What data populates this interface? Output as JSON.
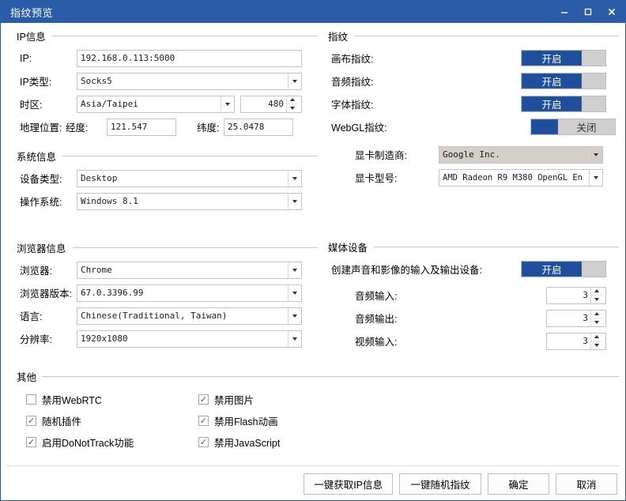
{
  "window": {
    "title": "指纹预览",
    "controls": {
      "minimize": "–",
      "maximize": "□",
      "close": "✕"
    },
    "titlebar_color": "#2a5ca8",
    "accent_color": "#1f4e9c"
  },
  "ip_section": {
    "title": "IP信息",
    "ip_label": "IP:",
    "ip_value": "192.168.0.113:5000",
    "ip_type_label": "IP类型:",
    "ip_type_value": "Socks5",
    "timezone_label": "时区:",
    "timezone_value": "Asia/Taipei",
    "timezone_offset": "480",
    "geo_label": "地理位置:",
    "longitude_label": "经度:",
    "longitude_value": "121.547",
    "latitude_label": "纬度:",
    "latitude_value": "25.0478"
  },
  "system_section": {
    "title": "系统信息",
    "device_label": "设备类型:",
    "device_value": "Desktop",
    "os_label": "操作系统:",
    "os_value": "Windows 8.1"
  },
  "browser_section": {
    "title": "浏览器信息",
    "browser_label": "浏览器:",
    "browser_value": "Chrome",
    "version_label": "浏览器版本:",
    "version_value": "67.0.3396.99",
    "language_label": "语言:",
    "language_value": "Chinese(Traditional, Taiwan)",
    "resolution_label": "分辨率:",
    "resolution_value": "1920x1080"
  },
  "fingerprint_section": {
    "title": "指纹",
    "canvas_label": "画布指纹:",
    "canvas_state": "开启",
    "audio_label": "音频指纹:",
    "audio_state": "开启",
    "font_label": "字体指纹:",
    "font_state": "开启",
    "webgl_label": "WebGL指纹:",
    "webgl_state": "关闭",
    "gpu_vendor_label": "显卡制造商:",
    "gpu_vendor_value": "Google Inc.",
    "gpu_model_label": "显卡型号:",
    "gpu_model_value": "AMD Radeon R9 M380 OpenGL En"
  },
  "media_section": {
    "title": "媒体设备",
    "create_label": "创建声音和影像的输入及输出设备:",
    "create_state": "开启",
    "audio_in_label": "音频输入:",
    "audio_in_value": "3",
    "audio_out_label": "音频输出:",
    "audio_out_value": "3",
    "video_in_label": "视频输入:",
    "video_in_value": "3"
  },
  "other_section": {
    "title": "其他",
    "checkboxes": [
      {
        "label": "禁用WebRTC",
        "checked": false
      },
      {
        "label": "禁用图片",
        "checked": true
      },
      {
        "label": "随机插件",
        "checked": true
      },
      {
        "label": "禁用Flash动画",
        "checked": true
      },
      {
        "label": "启用DoNotTrack功能",
        "checked": true
      },
      {
        "label": "禁用JavaScript",
        "checked": true
      }
    ]
  },
  "footer": {
    "get_ip_label": "一键获取IP信息",
    "random_fp_label": "一键随机指纹",
    "ok_label": "确定",
    "cancel_label": "取消"
  }
}
